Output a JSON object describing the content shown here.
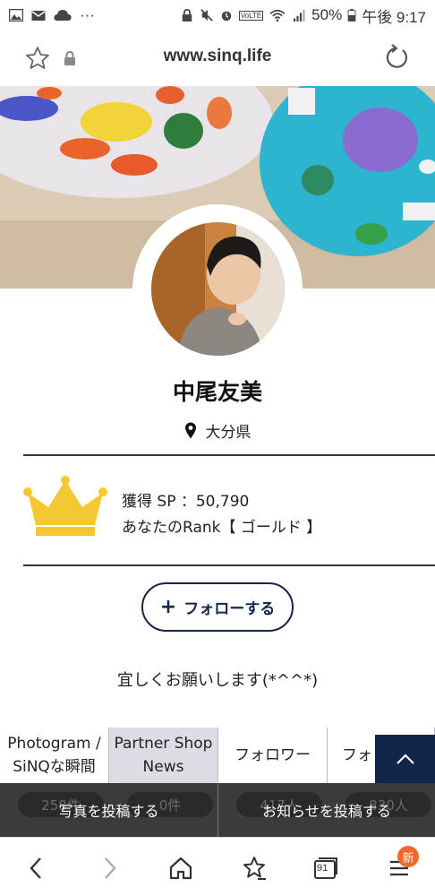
{
  "status_bar": {
    "battery": "50%",
    "time": "午後 9:17",
    "ellipsis": "···",
    "volte": "VoLTE"
  },
  "browser": {
    "url": "www.sinq.life",
    "tab_count": "91",
    "new_badge": "新"
  },
  "profile": {
    "name": "中尾友美",
    "location": "大分県",
    "sp_label": "獲得 SP ：50,790",
    "rank_label": "あなたのRank【 ゴールド 】",
    "follow_label": "フォローする",
    "follow_plus": "+",
    "bio": "宜しくお願いします(*^^*)"
  },
  "tabs": [
    {
      "label": "Photogram / SiNQな瞬間"
    },
    {
      "label": "Partner Shop News"
    },
    {
      "label": "フォロワー"
    },
    {
      "label": "フォ"
    }
  ],
  "counts": [
    "258件",
    "0件",
    "417人",
    "830人"
  ],
  "actions": {
    "post_photo": "写真を投稿する",
    "post_news": "お知らせを投稿する"
  },
  "icons": {
    "status": [
      "gallery-icon",
      "mail-icon",
      "cloud-icon",
      "lock-icon",
      "mute-icon",
      "alarm-icon",
      "wifi-icon",
      "signal-icon",
      "battery-icon"
    ],
    "url_bar": [
      "star-icon",
      "lock-icon",
      "reload-icon"
    ],
    "nav": [
      "back-icon",
      "forward-icon",
      "home-icon",
      "bookmark-star-icon",
      "tabs-icon",
      "menu-icon"
    ],
    "location": "location-pin-icon",
    "rank": "crown-icon",
    "scroll": "chevron-up-icon"
  },
  "colors": {
    "navy": "#0f2649",
    "crown": "#f5c832",
    "badge": "#f26a2a",
    "tab_active": "#dadde3"
  }
}
